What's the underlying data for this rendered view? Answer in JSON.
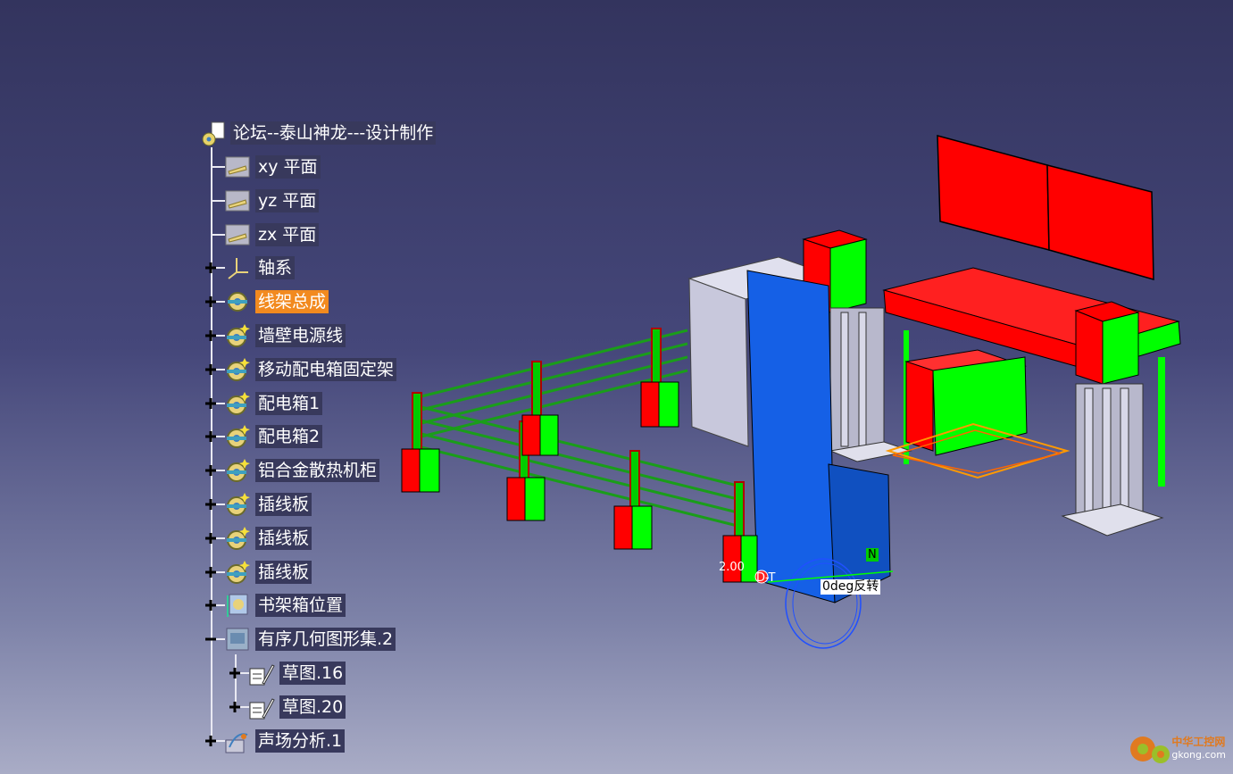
{
  "tree": {
    "root": {
      "label": "论坛--泰山神龙---设计制作",
      "icon": "product-document-icon"
    },
    "nodes": [
      {
        "label": "xy 平面",
        "icon": "plane-icon",
        "expander": "none"
      },
      {
        "label": "yz 平面",
        "icon": "plane-icon",
        "expander": "none"
      },
      {
        "label": "zx 平面",
        "icon": "plane-icon",
        "expander": "none"
      },
      {
        "label": "轴系",
        "icon": "axis-system-icon",
        "expander": "plus"
      },
      {
        "label": "线架总成",
        "icon": "assembly-gear-icon",
        "expander": "plus",
        "selected": true
      },
      {
        "label": "墙壁电源线",
        "icon": "part-gear-icon",
        "expander": "plus"
      },
      {
        "label": "移动配电箱固定架",
        "icon": "part-gear-icon",
        "expander": "plus"
      },
      {
        "label": "配电箱1",
        "icon": "part-gear-icon",
        "expander": "plus"
      },
      {
        "label": "配电箱2",
        "icon": "part-gear-icon",
        "expander": "plus"
      },
      {
        "label": "铝合金散热机柜",
        "icon": "part-gear-icon",
        "expander": "plus"
      },
      {
        "label": "插线板",
        "icon": "part-gear-icon",
        "expander": "plus"
      },
      {
        "label": "插线板",
        "icon": "part-gear-icon",
        "expander": "plus"
      },
      {
        "label": "插线板",
        "icon": "part-gear-icon",
        "expander": "plus"
      },
      {
        "label": "书架箱位置",
        "icon": "position-icon",
        "expander": "plus"
      },
      {
        "label": "有序几何图形集.2",
        "icon": "geometrical-set-icon",
        "expander": "minus"
      },
      {
        "label": "草图.16",
        "icon": "sketch-icon",
        "expander": "plus",
        "child": true
      },
      {
        "label": "草图.20",
        "icon": "sketch-icon",
        "expander": "plus",
        "child": true
      },
      {
        "label": "声场分析.1",
        "icon": "analysis-icon",
        "expander": "plus"
      }
    ]
  },
  "scene": {
    "dimension_value": "2.00",
    "dt_label": "D-T",
    "angle_label": "0deg反转",
    "n_label": "N"
  },
  "watermark": {
    "text": "中华工控网",
    "url_text": "gkong.com"
  },
  "colors": {
    "red": "#ff0000",
    "green": "#00ff00",
    "blue": "#1f5fd8",
    "grey": "#c8c8dc",
    "selected": "#f28a1f"
  }
}
